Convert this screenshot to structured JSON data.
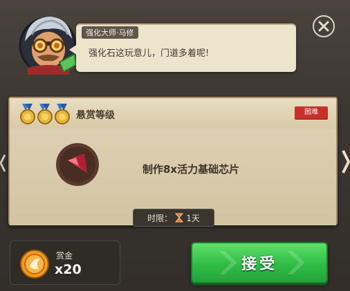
{
  "npc": {
    "name": "强化大师·马修",
    "line": "强化石这玩意儿，门道多着呢!"
  },
  "quest": {
    "rank_title": "悬赏等级",
    "medal_count": 3,
    "difficulty": "困难",
    "task": "制作8x活力基础芯片",
    "time_limit_label": "时限：",
    "time_limit_value": "1天",
    "item_icon": "red-crystal-shard-icon"
  },
  "reward": {
    "label": "赏金",
    "amount": "x20",
    "icon": "gold-coin-icon"
  },
  "actions": {
    "accept_label": "接受"
  },
  "colors": {
    "accept_green": "#2fbd45",
    "difficulty_red": "#c8302a",
    "card_header": "#e9ddc1",
    "background": "#3b3631"
  }
}
